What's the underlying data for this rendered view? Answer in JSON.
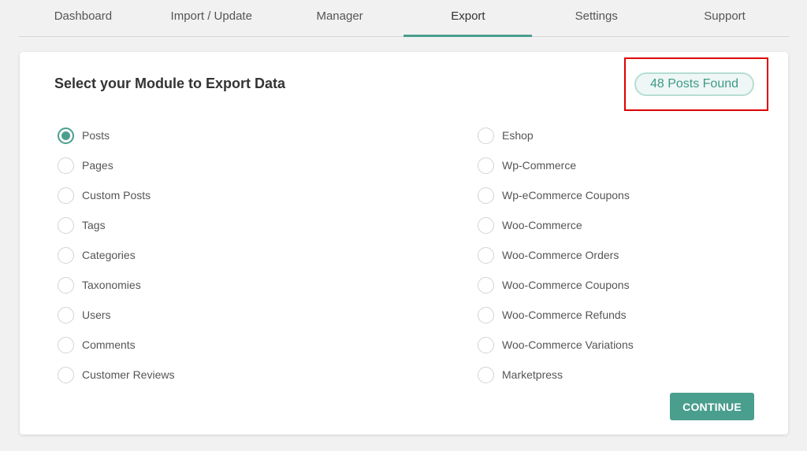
{
  "tabs": [
    "Dashboard",
    "Import / Update",
    "Manager",
    "Export",
    "Settings",
    "Support"
  ],
  "active_tab": "Export",
  "card": {
    "title": "Select your Module to Export Data",
    "badge": "48 Posts Found",
    "continue_label": "CONTINUE"
  },
  "modules_left": [
    "Posts",
    "Pages",
    "Custom Posts",
    "Tags",
    "Categories",
    "Taxonomies",
    "Users",
    "Comments",
    "Customer Reviews"
  ],
  "modules_right": [
    "Eshop",
    "Wp-Commerce",
    "Wp-eCommerce Coupons",
    "Woo-Commerce",
    "Woo-Commerce Orders",
    "Woo-Commerce Coupons",
    "Woo-Commerce Refunds",
    "Woo-Commerce Variations",
    "Marketpress"
  ],
  "selected_module": "Posts",
  "colors": {
    "accent": "#4a9e8e",
    "highlight": "#e00000"
  }
}
